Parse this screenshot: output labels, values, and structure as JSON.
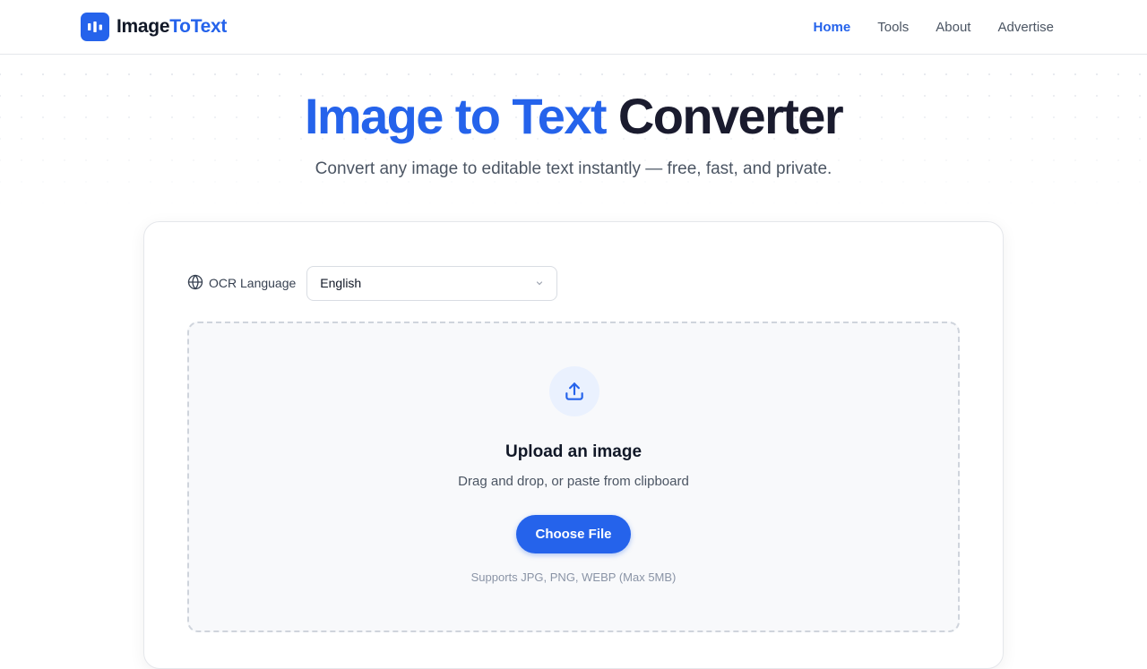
{
  "brand": {
    "name_part1": "Image",
    "name_part2": "ToText",
    "icon": "bar-chart-icon",
    "accent": "#2563eb"
  },
  "nav": [
    {
      "label": "Home",
      "active": true
    },
    {
      "label": "Tools",
      "active": false
    },
    {
      "label": "About",
      "active": false
    },
    {
      "label": "Advertise",
      "active": false
    }
  ],
  "hero": {
    "title_part1": "Image to Text",
    "title_part2": "Converter",
    "subtitle": "Convert any image to editable text instantly — free, fast, and private."
  },
  "ocr": {
    "label": "OCR Language",
    "label_icon": "globe-icon",
    "selected_language": "English"
  },
  "upload": {
    "icon": "upload-icon",
    "title": "Upload an image",
    "subtitle": "Drag and drop, or paste from clipboard",
    "button_label": "Choose File",
    "note": "Supports JPG, PNG, WEBP (Max 5MB)"
  }
}
